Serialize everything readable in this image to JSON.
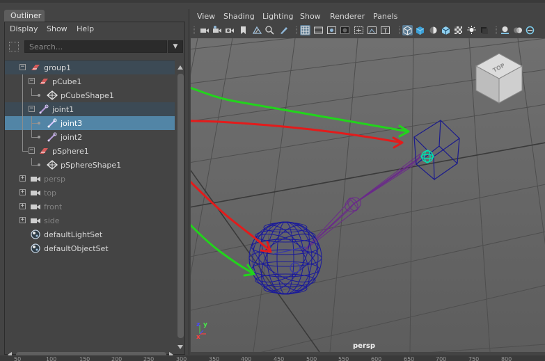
{
  "outliner": {
    "tab_label": "Outliner",
    "menu": [
      "Display",
      "Show",
      "Help"
    ],
    "search_placeholder": "Search...",
    "items": [
      {
        "label": "group1",
        "icon": "group-icon"
      },
      {
        "label": "pCube1",
        "icon": "transform-icon"
      },
      {
        "label": "pCubeShape1",
        "icon": "mesh-shape-icon"
      },
      {
        "label": "joint1",
        "icon": "joint-icon"
      },
      {
        "label": "joint3",
        "icon": "joint-icon"
      },
      {
        "label": "joint2",
        "icon": "joint-icon"
      },
      {
        "label": "pSphere1",
        "icon": "transform-icon"
      },
      {
        "label": "pSphereShape1",
        "icon": "mesh-shape-icon"
      },
      {
        "label": "persp",
        "icon": "camera-icon"
      },
      {
        "label": "top",
        "icon": "camera-icon"
      },
      {
        "label": "front",
        "icon": "camera-icon"
      },
      {
        "label": "side",
        "icon": "camera-icon"
      },
      {
        "label": "defaultLightSet",
        "icon": "set-icon"
      },
      {
        "label": "defaultObjectSet",
        "icon": "set-icon"
      }
    ],
    "selected_item": "joint3"
  },
  "viewport": {
    "menu": [
      "View",
      "Shading",
      "Lighting",
      "Show",
      "Renderer",
      "Panels"
    ],
    "camera_label": "persp",
    "view_cube_label": "TOP",
    "axis_labels": {
      "z": "z",
      "y": "y",
      "x": "x"
    }
  },
  "ruler": {
    "ticks": [
      "50",
      "100",
      "150",
      "200",
      "250",
      "300",
      "350",
      "400",
      "450",
      "500",
      "550",
      "600",
      "650",
      "700",
      "750",
      "800"
    ]
  },
  "colors": {
    "selection": "#5285a6",
    "wireframe": "#1a1a8c",
    "annotation_green": "#22d41c",
    "annotation_red": "#e31b1b"
  }
}
